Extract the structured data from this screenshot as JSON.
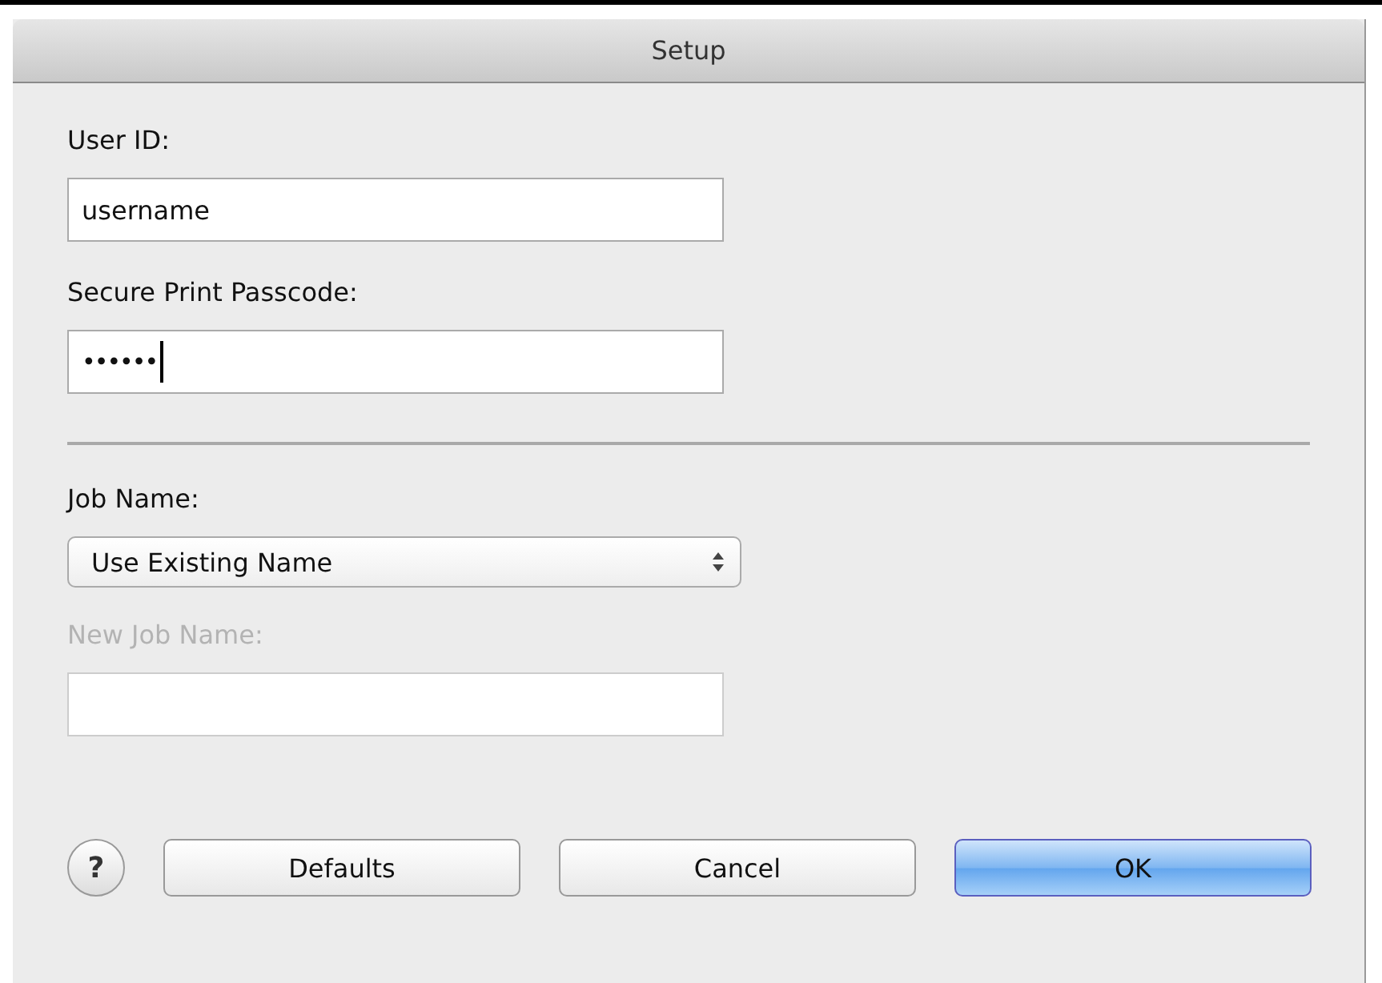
{
  "window": {
    "title": "Setup"
  },
  "fields": [
    {
      "kind": "text",
      "label": "User ID:",
      "value": "username",
      "disabled": false
    },
    {
      "kind": "password",
      "label": "Secure Print Passcode:",
      "value": "••••••",
      "disabled": false
    },
    {
      "kind": "divider"
    },
    {
      "kind": "select",
      "label": "Job Name:",
      "value": "Use Existing Name",
      "disabled": false
    },
    {
      "kind": "text",
      "label": "New Job Name:",
      "disabled": true
    }
  ],
  "help": {
    "label": "?"
  },
  "buttons": [
    {
      "label": "Defaults",
      "default": false
    },
    {
      "label": "Cancel",
      "default": false
    },
    {
      "label": "OK",
      "default": true
    }
  ]
}
